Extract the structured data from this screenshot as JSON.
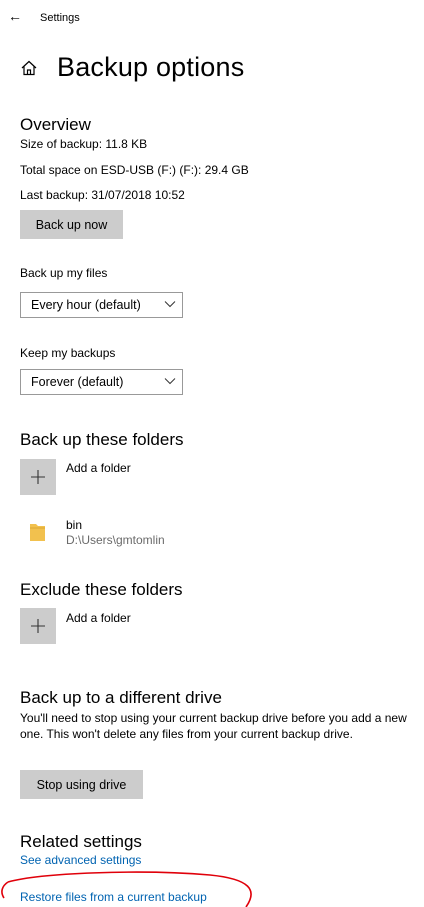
{
  "titlebar": {
    "back_glyph": "←",
    "title": "Settings"
  },
  "page": {
    "icon": "home-icon",
    "title": "Backup options"
  },
  "overview": {
    "heading": "Overview",
    "size_line": "Size of backup: 11.8 KB",
    "space_line": "Total space on ESD-USB (F:) (F:): 29.4 GB",
    "last_line": "Last backup: 31/07/2018 10:52",
    "backup_button": "Back up now"
  },
  "frequency": {
    "label": "Back up my files",
    "selected": "Every hour (default)"
  },
  "retention": {
    "label": "Keep my backups",
    "selected": "Forever (default)"
  },
  "include": {
    "heading": "Back up these folders",
    "add_label": "Add a folder",
    "folders": [
      {
        "name": "bin",
        "path": "D:\\Users\\gmtomlin"
      }
    ]
  },
  "exclude": {
    "heading": "Exclude these folders",
    "add_label": "Add a folder"
  },
  "different_drive": {
    "heading": "Back up to a different drive",
    "description": "You'll need to stop using your current backup drive before you add a new one. This won't delete any files from your current backup drive.",
    "stop_button": "Stop using drive"
  },
  "related": {
    "heading": "Related settings",
    "advanced_link": "See advanced settings",
    "restore_link": "Restore files from a current backup"
  },
  "colors": {
    "link": "#0063b1",
    "button_bg": "#cccccc",
    "annotation": "#e0000a",
    "folder": "#f2c14e"
  }
}
